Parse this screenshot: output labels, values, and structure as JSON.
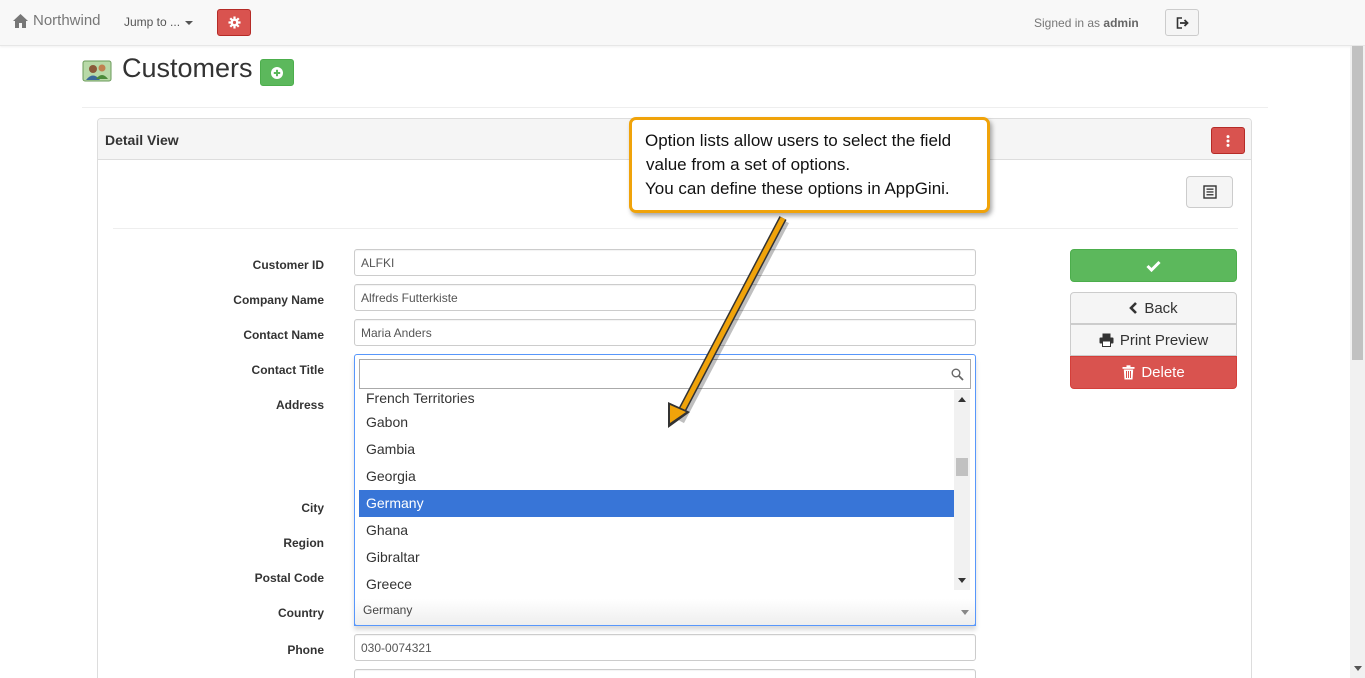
{
  "navbar": {
    "brand": "Northwind",
    "jump_label": "Jump to ...",
    "signed_prefix": "Signed in as",
    "username": "admin"
  },
  "page": {
    "title": "Customers"
  },
  "panel": {
    "title": "Detail View"
  },
  "form": {
    "labels": {
      "customer_id": "Customer ID",
      "company_name": "Company Name",
      "contact_name": "Contact Name",
      "contact_title": "Contact Title",
      "address": "Address",
      "city": "City",
      "region": "Region",
      "postal_code": "Postal Code",
      "country": "Country",
      "phone": "Phone"
    },
    "values": {
      "customer_id": "ALFKI",
      "company_name": "Alfreds Futterkiste",
      "contact_name": "Maria Anders",
      "country": "Germany",
      "phone": "030-0074321"
    }
  },
  "country_dropdown": {
    "search_placeholder": "",
    "options": [
      "French Territories",
      "Gabon",
      "Gambia",
      "Georgia",
      "Germany",
      "Ghana",
      "Gibraltar",
      "Greece"
    ],
    "selected": "Germany",
    "scroll_position_fraction": 0.35
  },
  "actions": {
    "back_label": "Back",
    "print_label": "Print Preview",
    "delete_label": "Delete"
  },
  "callout": {
    "line1": "Option lists allow users to select the field",
    "line2": "value from a set of options.",
    "line3": "You can define these options in AppGini."
  },
  "colors": {
    "accent_orange": "#f0a30a",
    "danger": "#d9534f",
    "success": "#5cb85c",
    "selected_option": "#3875d7"
  }
}
